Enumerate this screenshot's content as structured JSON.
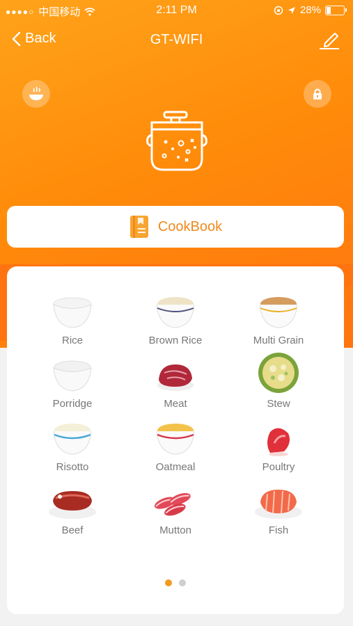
{
  "status_bar": {
    "carrier": "中国移动",
    "time": "2:11 PM",
    "battery": "28%"
  },
  "nav": {
    "back_label": "Back",
    "title": "GT-WIFI"
  },
  "cookbook": {
    "label": "CookBook"
  },
  "menu": [
    {
      "label": "Rice"
    },
    {
      "label": "Brown Rice"
    },
    {
      "label": "Multi Grain"
    },
    {
      "label": "Porridge"
    },
    {
      "label": "Meat"
    },
    {
      "label": "Stew"
    },
    {
      "label": "Risotto"
    },
    {
      "label": "Oatmeal"
    },
    {
      "label": "Poultry"
    },
    {
      "label": "Beef"
    },
    {
      "label": "Mutton"
    },
    {
      "label": "Fish"
    }
  ],
  "pager": {
    "pages": 2,
    "current": 1
  },
  "colors": {
    "accent": "#ff8c0a",
    "label": "#f08a1c"
  }
}
